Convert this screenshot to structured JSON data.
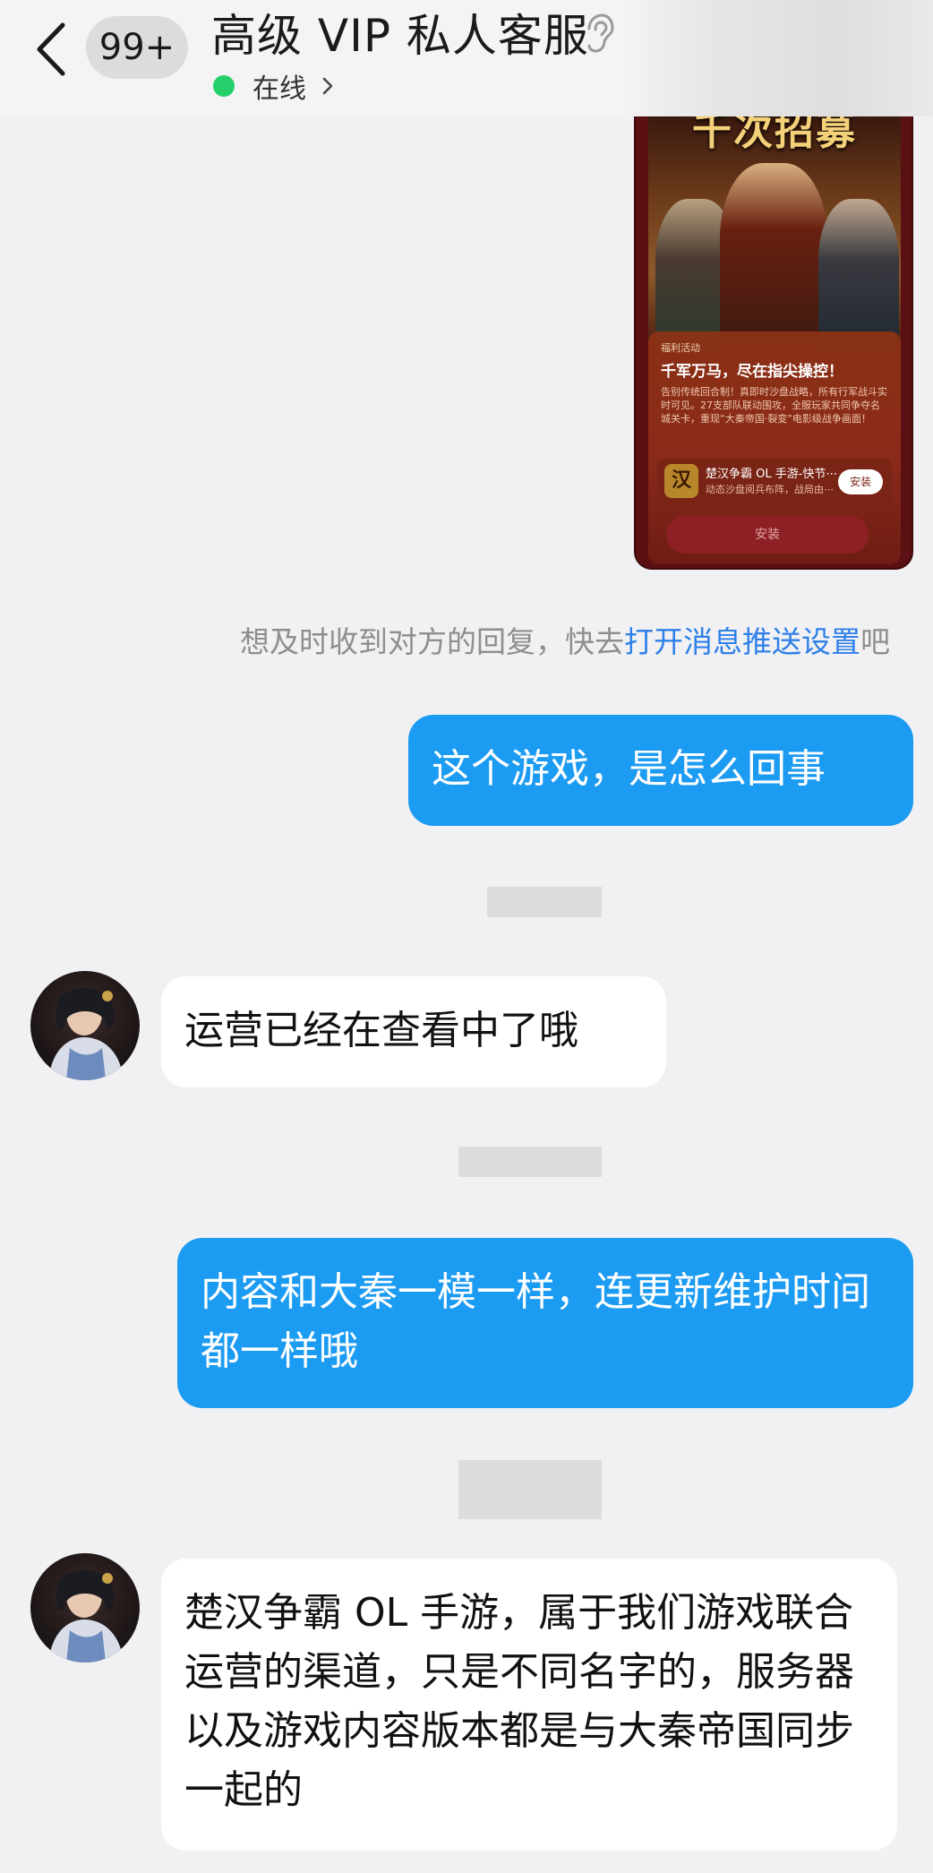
{
  "header": {
    "back_icon": "chevron-left-icon",
    "unread_badge": "99+",
    "title": "高级 VIP 私人客服",
    "ear_icon": "ear-icon",
    "status": "在线",
    "status_color": "#25d06a"
  },
  "ad_card": {
    "banner_title": "千次招募",
    "tag": "福利活动",
    "headline": "千军万马，尽在指尖操控！",
    "description": "告别传统回合制！真即时沙盘战略，所有行军战斗实时可见。27支部队联动围攻，全服玩家共同争夺名城关卡，重现“大秦帝国·裂变”电影级战争画面！",
    "app_icon_text": "汉",
    "app_name": "楚汉争霸 OL 手游-快节⋯",
    "app_subtitle": "动态沙盘阅兵布阵，战局由⋯",
    "install_small": "安装",
    "install_big": "安装"
  },
  "notice": {
    "prefix": "想及时收到对方的回复，快去",
    "link": "打开消息推送设置",
    "suffix": "吧"
  },
  "messages": [
    {
      "from": "me",
      "text": "这个游戏，是怎么回事"
    },
    {
      "from": "them",
      "text": "运营已经在查看中了哦"
    },
    {
      "from": "me",
      "text": "内容和大秦一模一样，连更新维护时间都一样哦"
    },
    {
      "from": "them",
      "text": "楚汉争霸 OL 手游，属于我们游戏联合运营的渠道，只是不同名字的，服务器以及游戏内容版本都是与大秦帝国同步一起的"
    }
  ],
  "colors": {
    "my_bubble": "#1c9bf2",
    "their_bubble": "#ffffff",
    "link": "#2f80e8",
    "background": "#f1f1f3"
  }
}
